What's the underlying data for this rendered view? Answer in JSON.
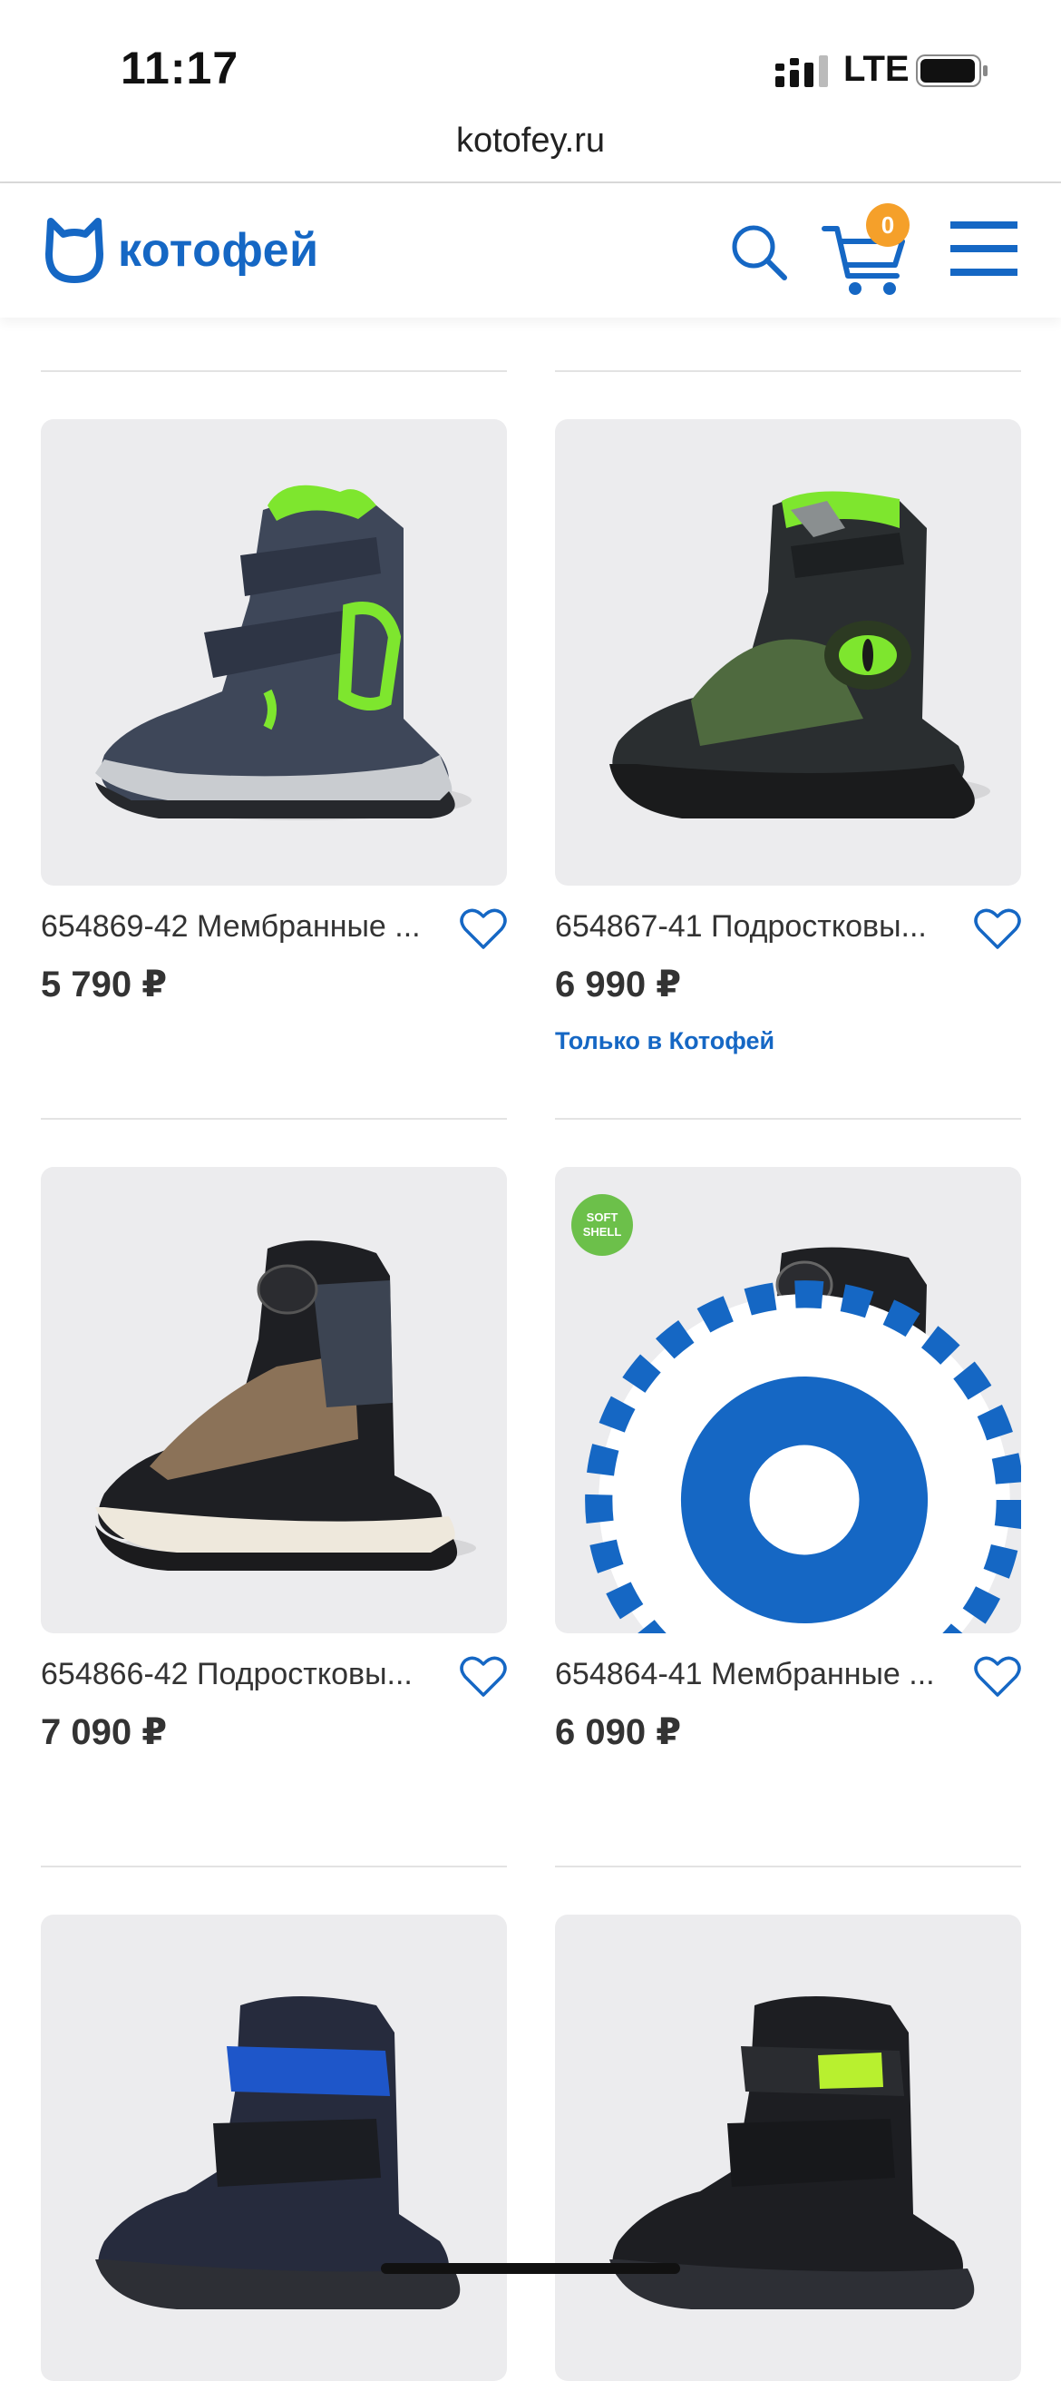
{
  "status_bar": {
    "time": "11:17",
    "network": "LTE"
  },
  "browser": {
    "url": "kotofey.ru"
  },
  "header": {
    "logo_text": "котофей",
    "cart_count": "0",
    "icons": [
      "cat-logo-icon",
      "search-icon",
      "cart-icon",
      "hamburger-menu-icon"
    ]
  },
  "colors": {
    "brand": "#1567c4",
    "badge": "#f5a02a",
    "soft_shell": "#6cc04a",
    "image_bg": "#ececee"
  },
  "products": [
    {
      "title": "654869-42 Мембранные ...",
      "price": "5 790 ₽",
      "tag": "",
      "image": "navy boot with neon green accents"
    },
    {
      "title": "654867-41 Подростковы...",
      "price": "6 990 ₽",
      "tag": "Только в Котофей",
      "image": "dark olive boot with dinosaur eye"
    },
    {
      "title": "654866-42 Подростковы...",
      "price": "7 090 ₽",
      "tag": "",
      "image": "black and brown boot with dial lacing"
    },
    {
      "title": "654864-41 Мембранные ...",
      "price": "6 090 ₽",
      "tag": "",
      "image": "black and grey boot with dial lacing",
      "badges": {
        "soft_shell": "SOFT SHELL"
      }
    },
    {
      "title": "",
      "price": "",
      "tag": "",
      "image": "navy velcro boot"
    },
    {
      "title": "",
      "price": "",
      "tag": "",
      "image": "black velcro boot with L.A. strap"
    }
  ]
}
